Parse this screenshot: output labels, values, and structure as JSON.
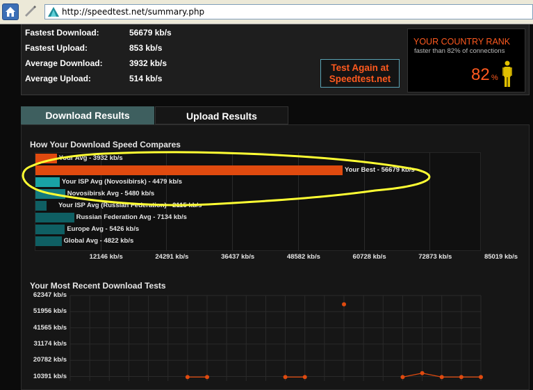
{
  "browser": {
    "url": "http://speedtest.net/summary.php"
  },
  "summary": {
    "stats": [
      {
        "label": "Fastest Download:",
        "value": "56679 kb/s"
      },
      {
        "label": "Fastest Upload:",
        "value": "853 kb/s"
      },
      {
        "label": "Average Download:",
        "value": "3932 kb/s"
      },
      {
        "label": "Average Upload:",
        "value": "514 kb/s"
      }
    ],
    "test_again": "Test Again at Speedtest.net",
    "rank": {
      "title": "YOUR COUNTRY RANK",
      "subtitle": "faster than 82% of connections",
      "percent": "82",
      "percent_sign": "%"
    }
  },
  "tabs": [
    {
      "label": "Download Results",
      "active": true
    },
    {
      "label": "Upload Results",
      "active": false
    }
  ],
  "compare": {
    "title": "How Your Download Speed Compares",
    "annotation_color": "#ffff33"
  },
  "recent": {
    "title": "Your Most Recent Download Tests"
  },
  "chart_data": [
    {
      "type": "bar",
      "orientation": "horizontal",
      "title": "How Your Download Speed Compares",
      "categories": [
        "Your Avg - 3932 kb/s",
        "Your Best - 56679 kb/s",
        "Your ISP Avg (Novosibirsk) - 4479 kb/s",
        "Novosibirsk Avg - 5480 kb/s",
        "Your ISP Avg (Russian Federation) - 2115 kb/s",
        "Russian Federation Avg - 7134 kb/s",
        "Europe Avg - 5426 kb/s",
        "Global Avg - 4822 kb/s"
      ],
      "values": [
        3932,
        56679,
        4479,
        5480,
        2115,
        7134,
        5426,
        4822
      ],
      "colors": [
        "#e04a0f",
        "#e04a0f",
        "#19a3a5",
        "#137a7e",
        "#0f5f63",
        "#0f5f63",
        "#0f5f63",
        "#0f5f63"
      ],
      "xticks": [
        "12146 kb/s",
        "24291 kb/s",
        "36437 kb/s",
        "48582 kb/s",
        "60728 kb/s",
        "72873 kb/s",
        "85019 kb/s"
      ],
      "xlim": [
        0,
        85019
      ],
      "grid": true
    },
    {
      "type": "line",
      "title": "Your Most Recent Download Tests",
      "yticks": [
        "62347 kb/s",
        "51956 kb/s",
        "41565 kb/s",
        "31174 kb/s",
        "20782 kb/s",
        "10391 kb/s"
      ],
      "ytick_values": [
        62347,
        51956,
        41565,
        31174,
        20782,
        10391
      ],
      "ylim": [
        0,
        62347
      ],
      "series": [
        {
          "color": "#e04a0f",
          "x": [
            1,
            2,
            3,
            4,
            5,
            6,
            7,
            8,
            9,
            10,
            11,
            12,
            13,
            14,
            15,
            16,
            17,
            18,
            19,
            20,
            21,
            22
          ],
          "values": [
            null,
            null,
            null,
            null,
            null,
            null,
            10000,
            10000,
            null,
            null,
            null,
            10000,
            10000,
            null,
            56679,
            null,
            null,
            10000,
            12500,
            10000,
            10000,
            10000
          ]
        }
      ],
      "grid": true
    }
  ]
}
